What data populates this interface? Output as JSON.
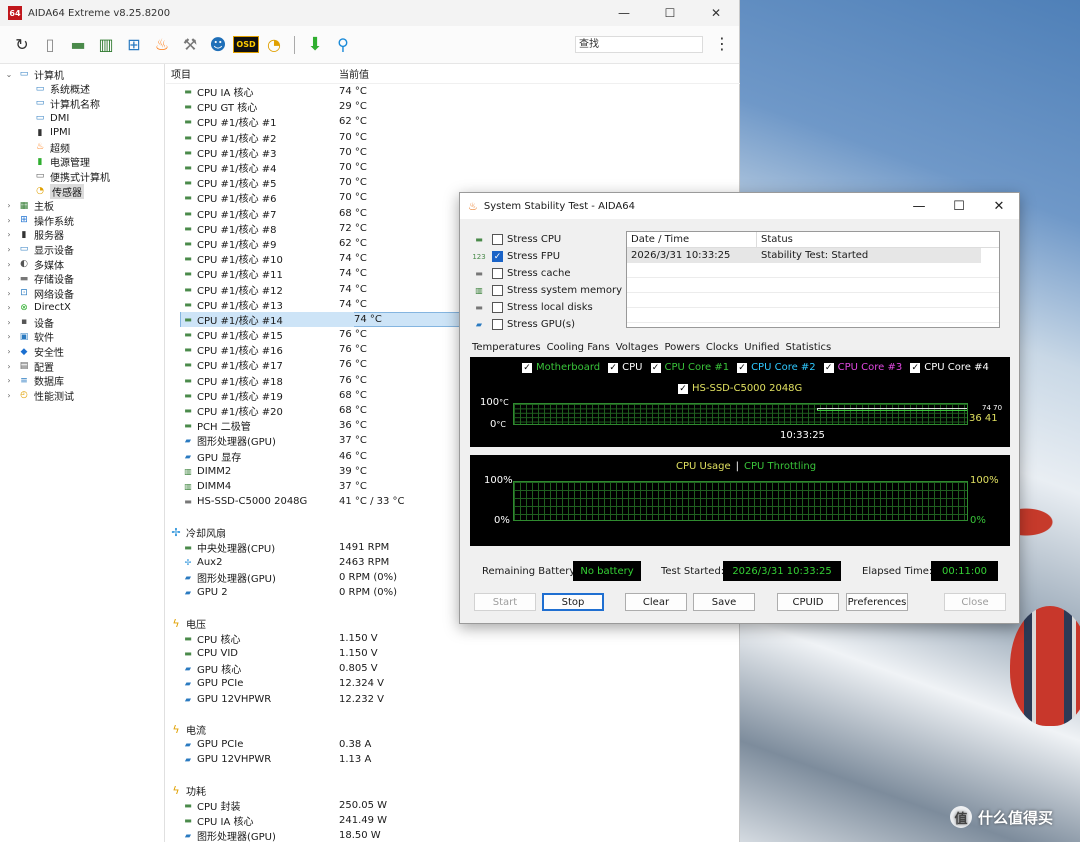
{
  "main_window": {
    "title": "AIDA64 Extreme v8.25.8200",
    "logo": "64",
    "controls": {
      "minimize": "—",
      "maximize": "☐",
      "close": "✕"
    }
  },
  "toolbar": {
    "icons": [
      "refresh-icon",
      "report-icon",
      "motherboard-icon",
      "memory-icon",
      "network-icon",
      "flame-icon",
      "tools-icon",
      "user-icon",
      "osd-icon",
      "gauge-icon",
      "download-icon",
      "search-icon"
    ],
    "osd_label": "OSD",
    "search_placeholder": "查找",
    "menu": "⋮"
  },
  "tree": [
    {
      "label": "计算机",
      "level": 0,
      "exp": "⌄",
      "icon": "computer-icon"
    },
    {
      "label": "系统概述",
      "level": 1,
      "icon": "monitor-icon"
    },
    {
      "label": "计算机名称",
      "level": 1,
      "icon": "monitor-icon"
    },
    {
      "label": "DMI",
      "level": 1,
      "icon": "monitor-icon"
    },
    {
      "label": "IPMI",
      "level": 1,
      "icon": "server-icon"
    },
    {
      "label": "超频",
      "level": 1,
      "icon": "flame-icon"
    },
    {
      "label": "电源管理",
      "level": 1,
      "icon": "battery-icon"
    },
    {
      "label": "便携式计算机",
      "level": 1,
      "icon": "laptop-icon"
    },
    {
      "label": "传感器",
      "level": 1,
      "icon": "gauge-icon",
      "selected": true
    },
    {
      "label": "主板",
      "level": 0,
      "exp": "›",
      "icon": "motherboard-icon"
    },
    {
      "label": "操作系统",
      "level": 0,
      "exp": "›",
      "icon": "windows-icon"
    },
    {
      "label": "服务器",
      "level": 0,
      "exp": "›",
      "icon": "server-icon"
    },
    {
      "label": "显示设备",
      "level": 0,
      "exp": "›",
      "icon": "monitor-icon"
    },
    {
      "label": "多媒体",
      "level": 0,
      "exp": "›",
      "icon": "speaker-icon"
    },
    {
      "label": "存储设备",
      "level": 0,
      "exp": "›",
      "icon": "disk-icon"
    },
    {
      "label": "网络设备",
      "level": 0,
      "exp": "›",
      "icon": "network-icon"
    },
    {
      "label": "DirectX",
      "level": 0,
      "exp": "›",
      "icon": "xbox-icon"
    },
    {
      "label": "设备",
      "level": 0,
      "exp": "›",
      "icon": "device-icon"
    },
    {
      "label": "软件",
      "level": 0,
      "exp": "›",
      "icon": "software-icon"
    },
    {
      "label": "安全性",
      "level": 0,
      "exp": "›",
      "icon": "shield-icon"
    },
    {
      "label": "配置",
      "level": 0,
      "exp": "›",
      "icon": "config-icon"
    },
    {
      "label": "数据库",
      "level": 0,
      "exp": "›",
      "icon": "database-icon"
    },
    {
      "label": "性能测试",
      "level": 0,
      "exp": "›",
      "icon": "benchmark-icon"
    }
  ],
  "list": {
    "col_item": "项目",
    "col_value": "当前值",
    "rows": [
      {
        "type": "row",
        "icon": "chip-icon",
        "label": "CPU IA 核心",
        "value": "74 °C"
      },
      {
        "type": "row",
        "icon": "chip-icon",
        "label": "CPU GT 核心",
        "value": "29 °C"
      },
      {
        "type": "row",
        "icon": "chip-icon",
        "label": "CPU #1/核心 #1",
        "value": "62 °C"
      },
      {
        "type": "row",
        "icon": "chip-icon",
        "label": "CPU #1/核心 #2",
        "value": "70 °C"
      },
      {
        "type": "row",
        "icon": "chip-icon",
        "label": "CPU #1/核心 #3",
        "value": "70 °C"
      },
      {
        "type": "row",
        "icon": "chip-icon",
        "label": "CPU #1/核心 #4",
        "value": "70 °C"
      },
      {
        "type": "row",
        "icon": "chip-icon",
        "label": "CPU #1/核心 #5",
        "value": "70 °C"
      },
      {
        "type": "row",
        "icon": "chip-icon",
        "label": "CPU #1/核心 #6",
        "value": "70 °C"
      },
      {
        "type": "row",
        "icon": "chip-icon",
        "label": "CPU #1/核心 #7",
        "value": "68 °C"
      },
      {
        "type": "row",
        "icon": "chip-icon",
        "label": "CPU #1/核心 #8",
        "value": "72 °C"
      },
      {
        "type": "row",
        "icon": "chip-icon",
        "label": "CPU #1/核心 #9",
        "value": "62 °C"
      },
      {
        "type": "row",
        "icon": "chip-icon",
        "label": "CPU #1/核心 #10",
        "value": "74 °C"
      },
      {
        "type": "row",
        "icon": "chip-icon",
        "label": "CPU #1/核心 #11",
        "value": "74 °C"
      },
      {
        "type": "row",
        "icon": "chip-icon",
        "label": "CPU #1/核心 #12",
        "value": "74 °C"
      },
      {
        "type": "row",
        "icon": "chip-icon",
        "label": "CPU #1/核心 #13",
        "value": "74 °C"
      },
      {
        "type": "row",
        "icon": "chip-icon",
        "label": "CPU #1/核心 #14",
        "value": "74 °C",
        "selected": true
      },
      {
        "type": "row",
        "icon": "chip-icon",
        "label": "CPU #1/核心 #15",
        "value": "76 °C"
      },
      {
        "type": "row",
        "icon": "chip-icon",
        "label": "CPU #1/核心 #16",
        "value": "76 °C"
      },
      {
        "type": "row",
        "icon": "chip-icon",
        "label": "CPU #1/核心 #17",
        "value": "76 °C"
      },
      {
        "type": "row",
        "icon": "chip-icon",
        "label": "CPU #1/核心 #18",
        "value": "76 °C"
      },
      {
        "type": "row",
        "icon": "chip-icon",
        "label": "CPU #1/核心 #19",
        "value": "68 °C"
      },
      {
        "type": "row",
        "icon": "chip-icon",
        "label": "CPU #1/核心 #20",
        "value": "68 °C"
      },
      {
        "type": "row",
        "icon": "chip-icon",
        "label": "PCH 二极管",
        "value": "36 °C"
      },
      {
        "type": "row",
        "icon": "gpu-icon",
        "label": "图形处理器(GPU)",
        "value": "37 °C"
      },
      {
        "type": "row",
        "icon": "gpu-icon",
        "label": "GPU 显存",
        "value": "46 °C"
      },
      {
        "type": "row",
        "icon": "memory-icon",
        "label": "DIMM2",
        "value": "39 °C"
      },
      {
        "type": "row",
        "icon": "memory-icon",
        "label": "DIMM4",
        "value": "37 °C"
      },
      {
        "type": "row",
        "icon": "disk-icon",
        "label": "HS-SSD-C5000 2048G",
        "value": "41 °C / 33 °C"
      },
      {
        "type": "gap"
      },
      {
        "type": "section",
        "icon": "fan-icon",
        "label": "冷却风扇"
      },
      {
        "type": "row",
        "icon": "chip-icon",
        "label": "中央处理器(CPU)",
        "value": "1491 RPM"
      },
      {
        "type": "row",
        "icon": "fan-icon",
        "label": "Aux2",
        "value": "2463 RPM"
      },
      {
        "type": "row",
        "icon": "gpu-icon",
        "label": "图形处理器(GPU)",
        "value": "0 RPM  (0%)"
      },
      {
        "type": "row",
        "icon": "gpu-icon",
        "label": "GPU 2",
        "value": "0 RPM  (0%)"
      },
      {
        "type": "gap"
      },
      {
        "type": "section",
        "icon": "voltage-icon",
        "label": "电压"
      },
      {
        "type": "row",
        "icon": "chip-icon",
        "label": "CPU 核心",
        "value": "1.150 V"
      },
      {
        "type": "row",
        "icon": "chip-icon",
        "label": "CPU VID",
        "value": "1.150 V"
      },
      {
        "type": "row",
        "icon": "gpu-icon",
        "label": "GPU 核心",
        "value": "0.805 V"
      },
      {
        "type": "row",
        "icon": "gpu-icon",
        "label": "GPU PCIe",
        "value": "12.324 V"
      },
      {
        "type": "row",
        "icon": "gpu-icon",
        "label": "GPU 12VHPWR",
        "value": "12.232 V"
      },
      {
        "type": "gap"
      },
      {
        "type": "section",
        "icon": "current-icon",
        "label": "电流"
      },
      {
        "type": "row",
        "icon": "gpu-icon",
        "label": "GPU PCIe",
        "value": "0.38 A"
      },
      {
        "type": "row",
        "icon": "gpu-icon",
        "label": "GPU 12VHPWR",
        "value": "1.13 A"
      },
      {
        "type": "gap"
      },
      {
        "type": "section",
        "icon": "power-icon",
        "label": "功耗"
      },
      {
        "type": "row",
        "icon": "chip-icon",
        "label": "CPU 封装",
        "value": "250.05 W"
      },
      {
        "type": "row",
        "icon": "chip-icon",
        "label": "CPU IA 核心",
        "value": "241.49 W"
      },
      {
        "type": "row",
        "icon": "gpu-icon",
        "label": "图形处理器(GPU)",
        "value": "18.50 W"
      }
    ]
  },
  "dialog": {
    "title": "System Stability Test - AIDA64",
    "controls": {
      "minimize": "—",
      "maximize": "☐",
      "close": "✕"
    },
    "stress_options": [
      {
        "label": "Stress CPU",
        "checked": false,
        "icon": "cpu-icon"
      },
      {
        "label": "Stress FPU",
        "checked": true,
        "icon": "fpu-icon",
        "icon_text": "123"
      },
      {
        "label": "Stress cache",
        "checked": false,
        "icon": "cache-icon"
      },
      {
        "label": "Stress system memory",
        "checked": false,
        "icon": "memory-icon"
      },
      {
        "label": "Stress local disks",
        "checked": false,
        "icon": "disk-icon"
      },
      {
        "label": "Stress GPU(s)",
        "checked": false,
        "icon": "gpu-icon"
      }
    ],
    "status_table": {
      "col_date": "Date / Time",
      "col_status": "Status",
      "rows": [
        {
          "date": "2026/3/31 10:33:25",
          "status": "Stability Test: Started"
        }
      ]
    },
    "tabs": [
      "Temperatures",
      "Cooling Fans",
      "Voltages",
      "Powers",
      "Clocks",
      "Unified",
      "Statistics"
    ],
    "temp_graph": {
      "legend": [
        {
          "label": "Motherboard",
          "color": "#39c43a"
        },
        {
          "label": "CPU",
          "color": "#ffffff"
        },
        {
          "label": "CPU Core #1",
          "color": "#39c43a"
        },
        {
          "label": "CPU Core #2",
          "color": "#2fc9ff"
        },
        {
          "label": "CPU Core #3",
          "color": "#e048e0"
        },
        {
          "label": "CPU Core #4",
          "color": "#ffffff"
        }
      ],
      "legend2": {
        "label": "HS-SSD-C5000 2048G",
        "color": "#e0e060"
      },
      "y_max": "100",
      "y_min": "0",
      "unit": "°C",
      "x_label": "10:33:25",
      "right_values": "36 41",
      "right_top": "74 70"
    },
    "usage_graph": {
      "title_a": "CPU Usage",
      "sep": "|",
      "title_b": "CPU Throttling",
      "y_max": "100%",
      "y_min": "0%"
    },
    "battery_label": "Remaining Battery:",
    "battery_value": "No battery",
    "started_label": "Test Started:",
    "started_value": "2026/3/31 10:33:25",
    "elapsed_label": "Elapsed Time:",
    "elapsed_value": "00:11:00",
    "buttons": {
      "start": "Start",
      "stop": "Stop",
      "clear": "Clear",
      "save": "Save",
      "cpuid": "CPUID",
      "preferences": "Preferences",
      "close": "Close"
    }
  },
  "watermark": {
    "badge": "值",
    "text": "什么值得买"
  }
}
